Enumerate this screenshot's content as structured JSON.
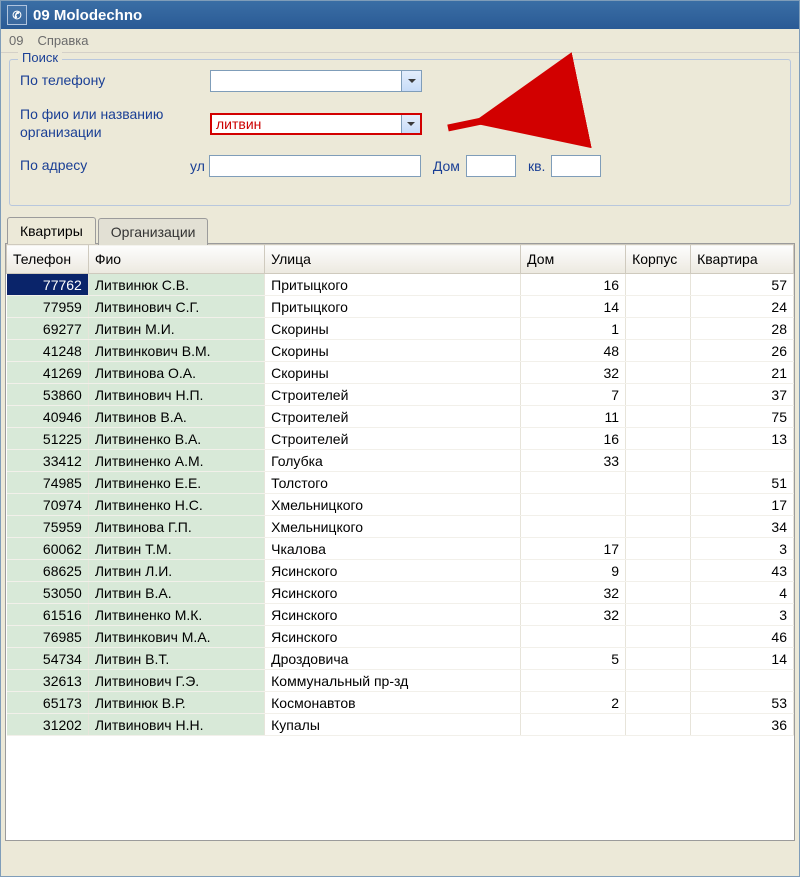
{
  "window": {
    "title": "09 Molodechno"
  },
  "menu": {
    "item1": "09",
    "item2": "Справка"
  },
  "search": {
    "legend": "Поиск",
    "by_phone_label": "По телефону",
    "by_phone_value": "",
    "by_fio_label": "По фио или названию организации",
    "by_fio_value": "литвин",
    "by_addr_label": "По адресу",
    "street_prefix": "ул",
    "street_value": "",
    "house_label": "Дом",
    "house_value": "",
    "flat_label": "кв.",
    "flat_value": ""
  },
  "tabs": {
    "apartments": "Квартиры",
    "orgs": "Организации"
  },
  "columns": {
    "phone": "Телефон",
    "fio": "Фио",
    "street": "Улица",
    "house": "Дом",
    "korpus": "Корпус",
    "flat": "Квартира"
  },
  "rows": [
    {
      "phone": "77762",
      "fio": "Литвинюк С.В.",
      "street": "Притыцкого",
      "house": "16",
      "korpus": "",
      "flat": "57"
    },
    {
      "phone": "77959",
      "fio": "Литвинович С.Г.",
      "street": "Притыцкого",
      "house": "14",
      "korpus": "",
      "flat": "24"
    },
    {
      "phone": "69277",
      "fio": "Литвин М.И.",
      "street": "Скорины",
      "house": "1",
      "korpus": "",
      "flat": "28"
    },
    {
      "phone": "41248",
      "fio": "Литвинкович В.М.",
      "street": "Скорины",
      "house": "48",
      "korpus": "",
      "flat": "26"
    },
    {
      "phone": "41269",
      "fio": "Литвинова О.А.",
      "street": "Скорины",
      "house": "32",
      "korpus": "",
      "flat": "21"
    },
    {
      "phone": "53860",
      "fio": "Литвинович Н.П.",
      "street": "Строителей",
      "house": "7",
      "korpus": "",
      "flat": "37"
    },
    {
      "phone": "40946",
      "fio": "Литвинов В.А.",
      "street": "Строителей",
      "house": "11",
      "korpus": "",
      "flat": "75"
    },
    {
      "phone": "51225",
      "fio": "Литвиненко В.А.",
      "street": "Строителей",
      "house": "16",
      "korpus": "",
      "flat": "13"
    },
    {
      "phone": "33412",
      "fio": "Литвиненко А.М.",
      "street": "Голубка",
      "house": "33",
      "korpus": "",
      "flat": ""
    },
    {
      "phone": "74985",
      "fio": "Литвиненко Е.Е.",
      "street": "Толстого",
      "house": "",
      "korpus": "",
      "flat": "51"
    },
    {
      "phone": "70974",
      "fio": "Литвиненко Н.С.",
      "street": "Хмельницкого",
      "house": "",
      "korpus": "",
      "flat": "17"
    },
    {
      "phone": "75959",
      "fio": "Литвинова Г.П.",
      "street": "Хмельницкого",
      "house": "",
      "korpus": "",
      "flat": "34"
    },
    {
      "phone": "60062",
      "fio": "Литвин Т.М.",
      "street": "Чкалова",
      "house": "17",
      "korpus": "",
      "flat": "3"
    },
    {
      "phone": "68625",
      "fio": "Литвин Л.И.",
      "street": "Ясинского",
      "house": "9",
      "korpus": "",
      "flat": "43"
    },
    {
      "phone": "53050",
      "fio": "Литвин В.А.",
      "street": "Ясинского",
      "house": "32",
      "korpus": "",
      "flat": "4"
    },
    {
      "phone": "61516",
      "fio": "Литвиненко М.К.",
      "street": "Ясинского",
      "house": "32",
      "korpus": "",
      "flat": "3"
    },
    {
      "phone": "76985",
      "fio": "Литвинкович М.А.",
      "street": "Ясинского",
      "house": "",
      "korpus": "",
      "flat": "46"
    },
    {
      "phone": "54734",
      "fio": "Литвин В.Т.",
      "street": "Дроздовича",
      "house": "5",
      "korpus": "",
      "flat": "14"
    },
    {
      "phone": "32613",
      "fio": "Литвинович Г.Э.",
      "street": "Коммунальный пр-зд",
      "house": "",
      "korpus": "",
      "flat": ""
    },
    {
      "phone": "65173",
      "fio": "Литвинюк В.Р.",
      "street": "Космонавтов",
      "house": "2",
      "korpus": "",
      "flat": "53"
    },
    {
      "phone": "31202",
      "fio": "Литвинович Н.Н.",
      "street": "Купалы",
      "house": "",
      "korpus": "",
      "flat": "36"
    }
  ]
}
